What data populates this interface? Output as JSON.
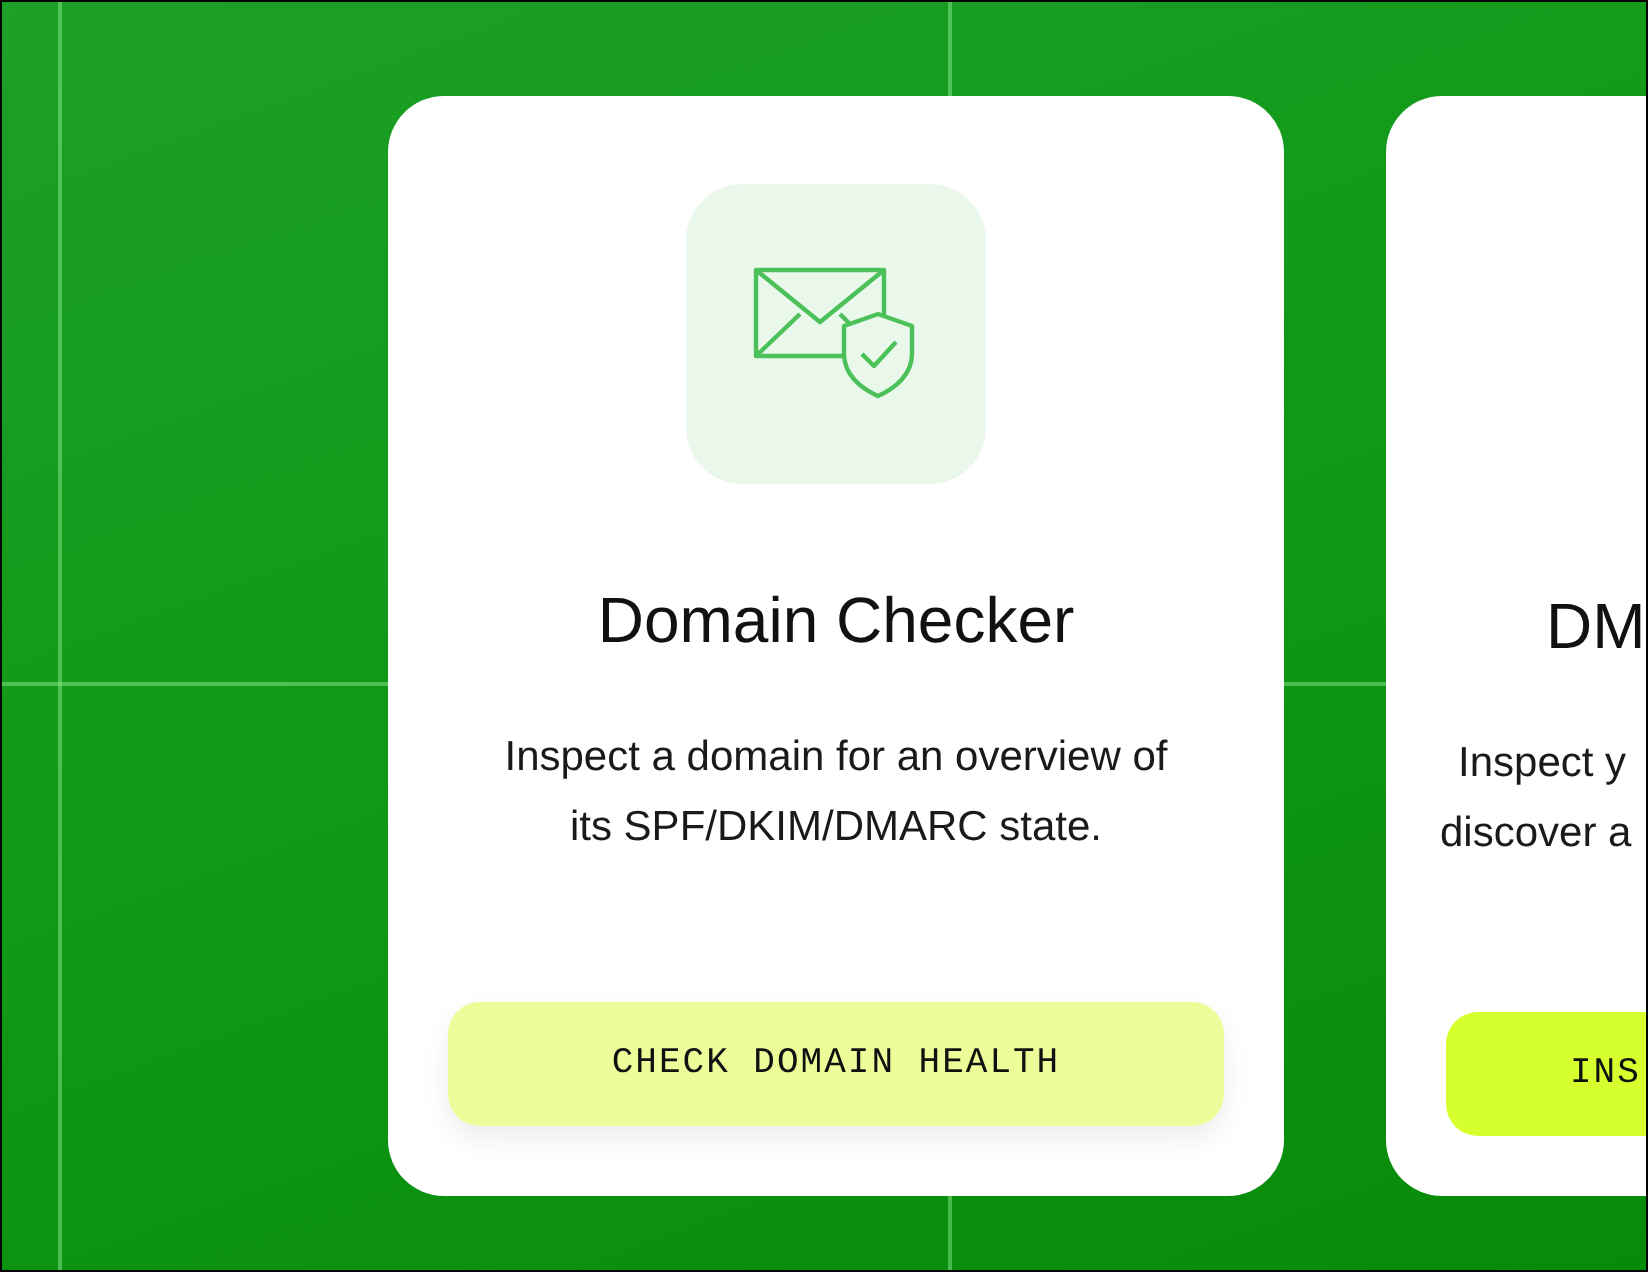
{
  "cards": [
    {
      "title": "Domain Checker",
      "description_lines": [
        "Inspect a domain for an overview of",
        "its SPF/DKIM/DMARC state."
      ],
      "button": {
        "label": "CHECK DOMAIN HEALTH",
        "hovered": true
      },
      "has_icon": true,
      "cut_off": false
    },
    {
      "title": "DM",
      "description_lines": [
        "Inspect y",
        "discover a"
      ],
      "button": {
        "label": "INS",
        "hovered": false
      },
      "has_icon": false,
      "cut_off": true
    }
  ]
}
